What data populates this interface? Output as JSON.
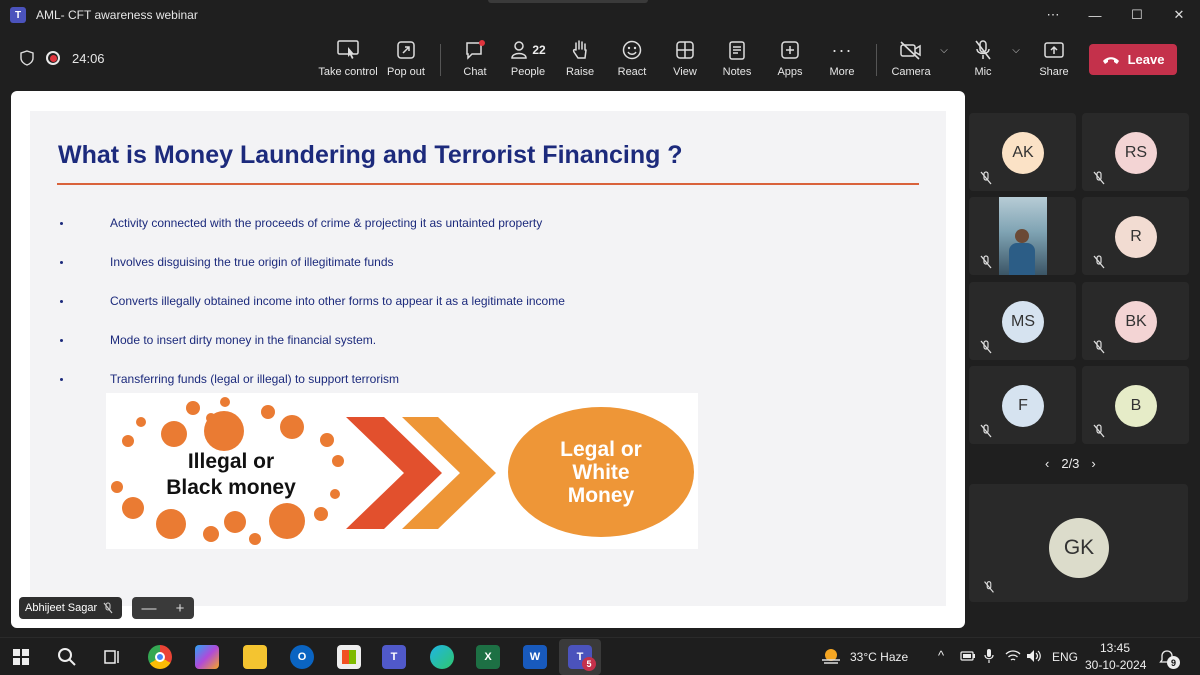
{
  "window": {
    "title": "AML- CFT awareness webinar",
    "app_badge": "T"
  },
  "meeting": {
    "elapsed": "24:06"
  },
  "toolbar": {
    "take_control": "Take control",
    "pop_out": "Pop out",
    "chat": "Chat",
    "people": "People",
    "people_count": "22",
    "raise": "Raise",
    "react": "React",
    "view": "View",
    "notes": "Notes",
    "apps": "Apps",
    "more": "More",
    "camera": "Camera",
    "mic": "Mic",
    "share": "Share",
    "leave": "Leave"
  },
  "slide": {
    "title": "What is Money Laundering and Terrorist Financing ?",
    "bullets": [
      "Activity connected with the proceeds of crime & projecting it as untainted property",
      "Involves disguising the true origin of illegitimate funds",
      "Converts illegally obtained income into other forms to appear it as a legitimate income",
      "Mode to insert dirty money in the financial system.",
      "Transferring funds (legal or illegal) to support terrorism"
    ],
    "graphic": {
      "left_line1": "Illegal or",
      "left_line2": "Black money",
      "right_line1": "Legal or",
      "right_line2": "White",
      "right_line3": "Money",
      "accent_color": "#ea7b33"
    }
  },
  "speaker": {
    "name": "Abhijeet Sagar"
  },
  "zoom": {
    "minus": "—",
    "plus": "+"
  },
  "participants": [
    {
      "initials": "AK",
      "color": "#fbe2c6"
    },
    {
      "initials": "RS",
      "color": "#f3d4d4"
    },
    {
      "initials": "",
      "video": true
    },
    {
      "initials": "R",
      "color": "#f2dcd2"
    },
    {
      "initials": "MS",
      "color": "#d6e3f0"
    },
    {
      "initials": "BK",
      "color": "#f3d4d4"
    },
    {
      "initials": "F",
      "color": "#d6e3f0"
    },
    {
      "initials": "B",
      "color": "#e6ecc8"
    }
  ],
  "pager": {
    "label": "2/3"
  },
  "self": {
    "initials": "GK"
  },
  "taskbar": {
    "weather": "33°C  Haze",
    "lang": "ENG",
    "time": "13:45",
    "date": "30-10-2024",
    "notif_count": "9",
    "teams_badge": "5"
  }
}
